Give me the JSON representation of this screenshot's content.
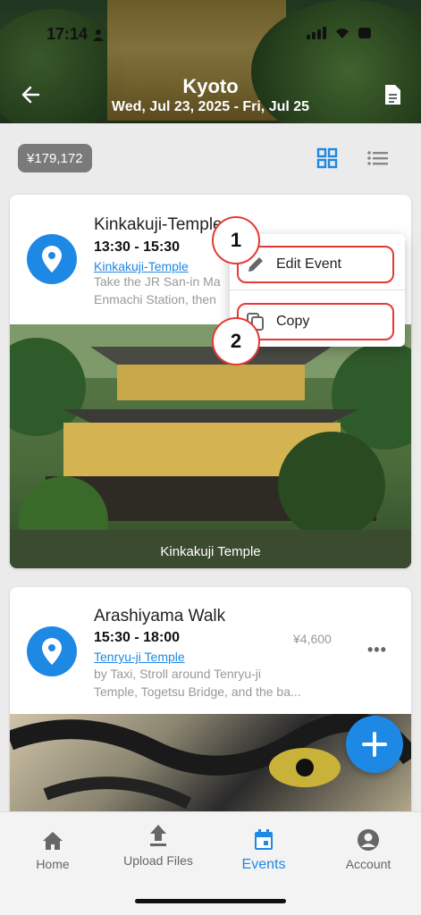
{
  "status_bar": {
    "time": "17:14"
  },
  "header": {
    "title": "Kyoto",
    "dates": "Wed, Jul 23, 2025 - Fri, Jul 25"
  },
  "toolbar": {
    "budget": "¥179,172"
  },
  "events": [
    {
      "title": "Kinkakuji-Temple",
      "time": "13:30 - 15:30",
      "location": "Kinkakuji-Temple",
      "description_line1": "Take the JR San-in Ma",
      "description_line2": "Enmachi Station, then",
      "photo_caption": "Kinkakuji Temple"
    },
    {
      "title": "Arashiyama Walk",
      "time": "15:30 - 18:00",
      "price": "¥4,600",
      "location": "Tenryu-ji Temple",
      "description_line1": "by Taxi, Stroll around Tenryu-ji",
      "description_line2": "Temple, Togetsu Bridge, and the ba...",
      "more": "•••"
    }
  ],
  "context_menu": {
    "items": [
      {
        "label": "Edit Event",
        "icon": "pencil-icon",
        "badge": "1"
      },
      {
        "label": "Copy",
        "icon": "copy-icon",
        "badge": "2"
      }
    ]
  },
  "bottom_nav": {
    "items": [
      {
        "label": "Home",
        "icon": "home-icon"
      },
      {
        "label": "Upload Files",
        "icon": "upload-icon"
      },
      {
        "label": "Events",
        "icon": "calendar-icon",
        "active": true
      },
      {
        "label": "Account",
        "icon": "account-icon"
      }
    ]
  },
  "colors": {
    "accent": "#1e88e5",
    "highlight": "#e53935"
  }
}
